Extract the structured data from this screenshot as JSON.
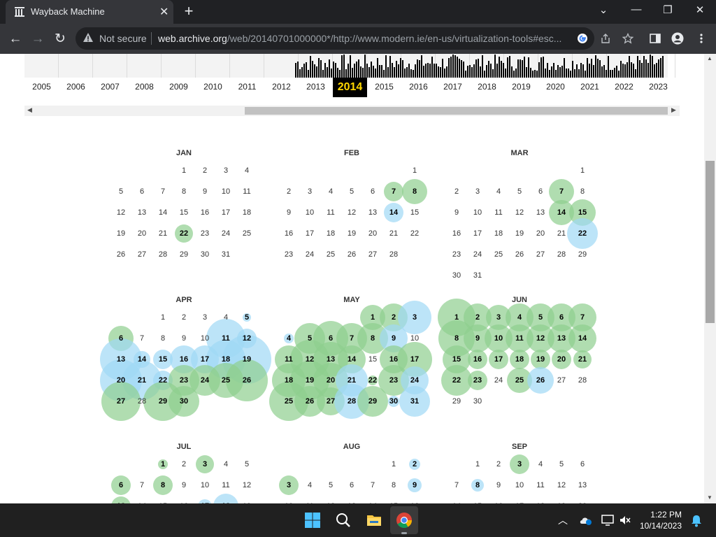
{
  "browser": {
    "tab_title": "Wayback Machine",
    "not_secure": "Not secure",
    "url_host": "web.archive.org",
    "url_path": "/web/20140701000000*/http://www.modern.ie/en-us/virtualization-tools#esc..."
  },
  "timeline": {
    "years": [
      "2005",
      "2006",
      "2007",
      "2008",
      "2009",
      "2010",
      "2011",
      "2012",
      "2013",
      "2014",
      "2015",
      "2016",
      "2017",
      "2018",
      "2019",
      "2020",
      "2021",
      "2022",
      "2023"
    ],
    "selected_year": "2014"
  },
  "calendar": {
    "month_names": [
      "JAN",
      "FEB",
      "MAR",
      "APR",
      "MAY",
      "JUN",
      "JUL",
      "AUG",
      "SEP"
    ]
  },
  "taskbar": {
    "time": "1:22 PM",
    "date": "10/14/2023"
  },
  "colors": {
    "green_bubble": "#8fcf8f",
    "blue_bubble": "#9fd8f5",
    "selected_year_text": "#ffd700"
  }
}
